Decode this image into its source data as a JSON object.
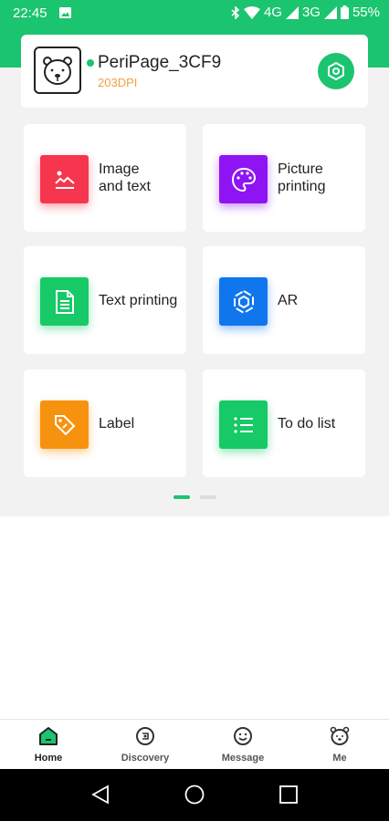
{
  "status_bar": {
    "time": "22:45",
    "network_1": "4G",
    "network_2": "3G",
    "battery": "55%"
  },
  "device": {
    "name": "PeriPage_3CF9",
    "dpi": "203DPI",
    "online_color": "#1bc46e"
  },
  "features": [
    {
      "label": "Image\nand text",
      "icon": "image-icon",
      "color": "#f5364e"
    },
    {
      "label": "Picture printing",
      "icon": "palette-icon",
      "color": "#8f14f3"
    },
    {
      "label": "Text printing",
      "icon": "document-icon",
      "color": "#17c967"
    },
    {
      "label": "AR",
      "icon": "ar-hexagon-icon",
      "color": "#0f76ee"
    },
    {
      "label": "Label",
      "icon": "tag-icon",
      "color": "#f7920f"
    },
    {
      "label": "To do list",
      "icon": "checklist-icon",
      "color": "#17c967"
    }
  ],
  "pager": {
    "active_page": 1,
    "total_pages": 2
  },
  "tabs": [
    {
      "label": "Home",
      "icon": "home-icon",
      "active": true
    },
    {
      "label": "Discovery",
      "icon": "discovery-icon",
      "active": false
    },
    {
      "label": "Message",
      "icon": "smile-icon",
      "active": false
    },
    {
      "label": "Me",
      "icon": "bear-icon",
      "active": false
    }
  ],
  "colors": {
    "accent": "#1bc46e",
    "background": "#f2f2f2"
  }
}
